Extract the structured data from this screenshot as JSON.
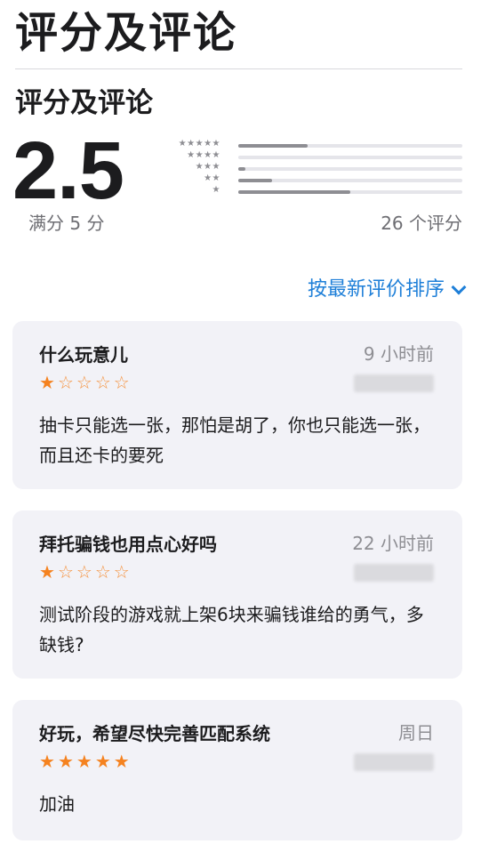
{
  "header": {
    "title": "评分及评论"
  },
  "ratings": {
    "section_title": "评分及评论",
    "average": "2.5",
    "out_of": "满分 5 分",
    "count": "26 个评分",
    "histogram": [
      {
        "stars": "★★★★★",
        "fraction": 0.31
      },
      {
        "stars": "★★★★",
        "fraction": 0.0
      },
      {
        "stars": "★★★",
        "fraction": 0.03
      },
      {
        "stars": "★★",
        "fraction": 0.15
      },
      {
        "stars": "★",
        "fraction": 0.5
      }
    ]
  },
  "sort": {
    "label": "按最新评价排序",
    "icon": "chevron-down-icon"
  },
  "reviews": [
    {
      "title": "什么玩意儿",
      "date": "9 小时前",
      "rating": 1,
      "body": "抽卡只能选一张，那怕是胡了，你也只能选一张，而且还卡的要死"
    },
    {
      "title": "拜托骗钱也用点心好吗",
      "date": "22 小时前",
      "rating": 1,
      "body": "测试阶段的游戏就上架6块来骗钱谁给的勇气，多缺钱?"
    },
    {
      "title": "好玩，希望尽快完善匹配系统",
      "date": "周日",
      "rating": 5,
      "body": "加油"
    }
  ],
  "colors": {
    "accent": "#1e7fd8",
    "star": "#f5821f",
    "card_bg": "#f2f2f7"
  }
}
